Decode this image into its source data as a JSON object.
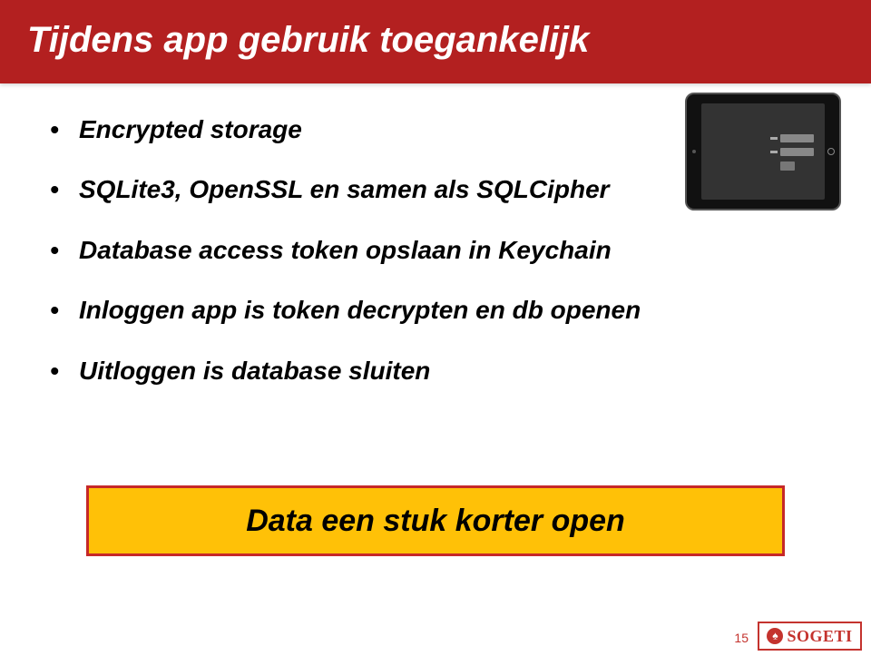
{
  "title": "Tijdens app gebruik toegankelijk",
  "bullets": [
    "Encrypted storage",
    "SQLite3, OpenSSL en samen als SQLCipher",
    "Database access token opslaan in Keychain",
    "Inloggen app is token decrypten en db openen",
    "Uitloggen is database sluiten"
  ],
  "highlight": "Data een stuk korter open",
  "page_number": "15",
  "logo_text": "SOGETI"
}
